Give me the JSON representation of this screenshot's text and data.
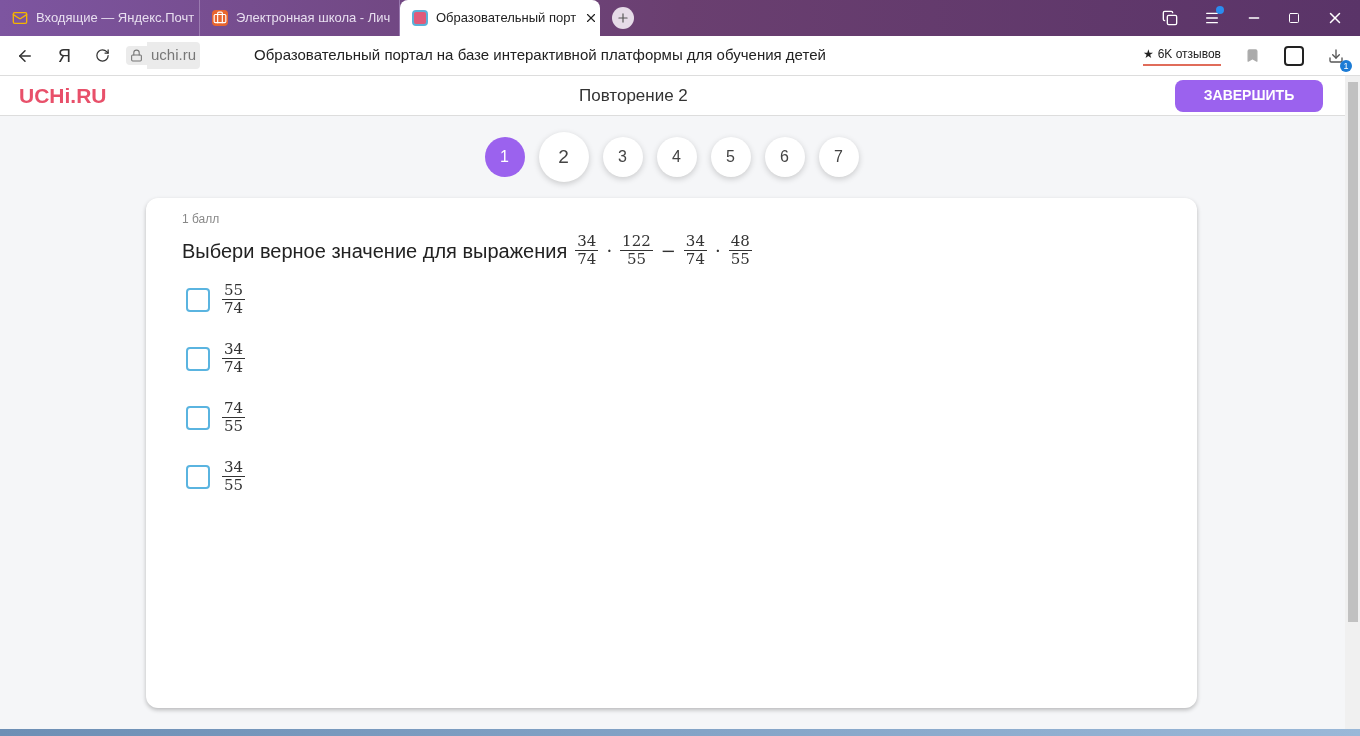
{
  "browser": {
    "tabs": [
      {
        "title": "Входящие — Яндекс.Почт",
        "kind": "mail",
        "selected": false
      },
      {
        "title": "Электронная школа - Лич",
        "kind": "briefcase",
        "selected": false
      },
      {
        "title": "Образовательный порт",
        "kind": "site",
        "selected": true
      }
    ],
    "home_logo": "Я",
    "address": "uchi.ru",
    "page_title": "Образовательный портал на базе интерактивной платформы для обучения детей",
    "reviews": "★ 6K отзывов",
    "downloads_badge": "1"
  },
  "header": {
    "logo": "UCHi.RU",
    "title": "Повторение 2",
    "finish_button": "ЗАВЕРШИТЬ"
  },
  "steps": [
    {
      "label": "1",
      "selected": true,
      "hovered": false
    },
    {
      "label": "2",
      "selected": false,
      "hovered": true
    },
    {
      "label": "3",
      "selected": false,
      "hovered": false
    },
    {
      "label": "4",
      "selected": false,
      "hovered": false
    },
    {
      "label": "5",
      "selected": false,
      "hovered": false
    },
    {
      "label": "6",
      "selected": false,
      "hovered": false
    },
    {
      "label": "7",
      "selected": false,
      "hovered": false
    }
  ],
  "question": {
    "points": "1 балл",
    "text": "Выбери верное значение для выражения",
    "expression": [
      {
        "kind": "fraction",
        "num": "34",
        "den": "74"
      },
      {
        "kind": "operator",
        "text": "·"
      },
      {
        "kind": "fraction",
        "num": "122",
        "den": "55"
      },
      {
        "kind": "operator",
        "text": "−"
      },
      {
        "kind": "fraction",
        "num": "34",
        "den": "74"
      },
      {
        "kind": "operator",
        "text": "·"
      },
      {
        "kind": "fraction",
        "num": "48",
        "den": "55"
      }
    ],
    "options": [
      {
        "num": "55",
        "den": "74",
        "checked": false
      },
      {
        "num": "34",
        "den": "74",
        "checked": false
      },
      {
        "num": "74",
        "den": "55",
        "checked": false
      },
      {
        "num": "34",
        "den": "55",
        "checked": false
      }
    ]
  }
}
